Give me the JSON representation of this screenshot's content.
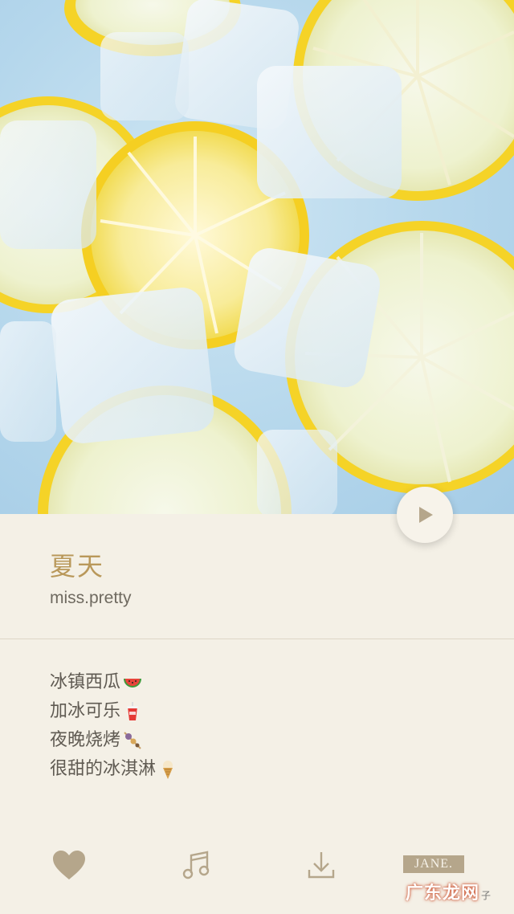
{
  "song": {
    "title": "夏天",
    "artist": "miss.pretty"
  },
  "lyrics": [
    {
      "text": "冰镇西瓜",
      "emoji": "watermelon-icon"
    },
    {
      "text": "加冰可乐",
      "emoji": "cola-cup-icon"
    },
    {
      "text": "夜晚烧烤",
      "emoji": "skewer-icon"
    },
    {
      "text": "很甜的冰淇淋",
      "emoji": "ice-cream-icon"
    }
  ],
  "toolbar": {
    "brand_label": "JANE.",
    "icons": [
      "heart-icon",
      "music-note-icon",
      "download-icon"
    ]
  },
  "watermark": {
    "text": "广东龙网",
    "small": "子"
  },
  "colors": {
    "background": "#f4f0e6",
    "accent": "#b9985a",
    "icon": "#b5a68b",
    "lemon": "#f5d327"
  }
}
